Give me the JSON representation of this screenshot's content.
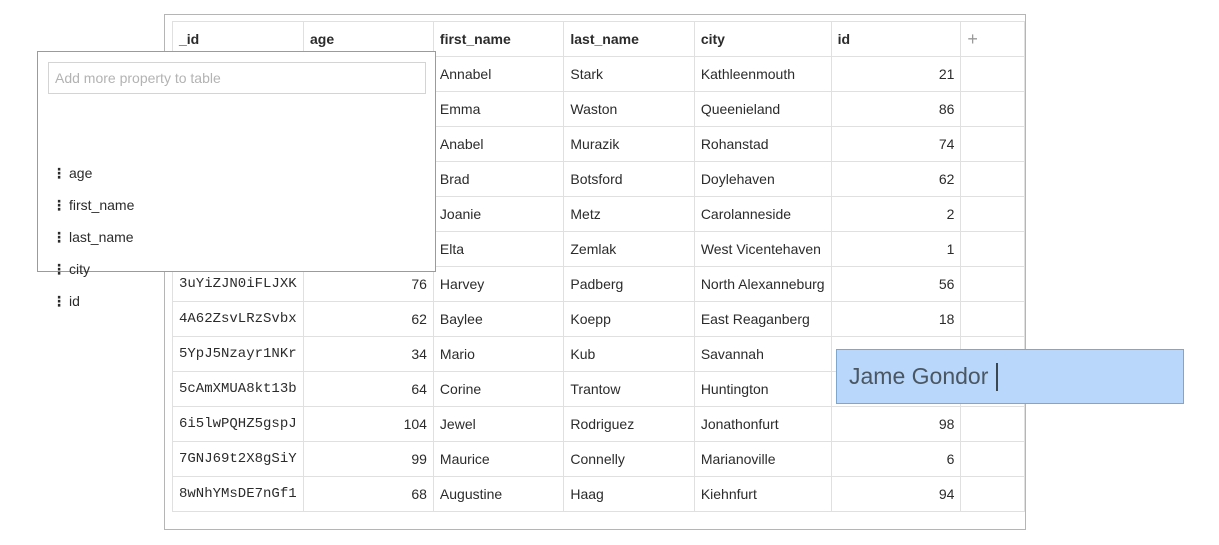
{
  "table": {
    "columns": [
      "_id",
      "age",
      "first_name",
      "last_name",
      "city",
      "id"
    ],
    "add_column_label": "+",
    "rows": [
      {
        "_id": "",
        "age": "",
        "first_name": "Annabel",
        "last_name": "Stark",
        "city": "Kathleenmouth",
        "id": "21"
      },
      {
        "_id": "",
        "age": "",
        "first_name": "Emma",
        "last_name": "Waston",
        "city": "Queenieland",
        "id": "86"
      },
      {
        "_id": "",
        "age": "",
        "first_name": "Anabel",
        "last_name": "Murazik",
        "city": "Rohanstad",
        "id": "74"
      },
      {
        "_id": "",
        "age": "",
        "first_name": "Brad",
        "last_name": "Botsford",
        "city": "Doylehaven",
        "id": "62"
      },
      {
        "_id": "",
        "age": "",
        "first_name": "Joanie",
        "last_name": "Metz",
        "city": "Carolanneside",
        "id": "2"
      },
      {
        "_id": "",
        "age": "",
        "first_name": "Elta",
        "last_name": "Zemlak",
        "city": "West Vicentehaven",
        "id": "1"
      },
      {
        "_id": "3uYiZJN0iFLJXK",
        "age": "76",
        "first_name": "Harvey",
        "last_name": "Padberg",
        "city": "North Alexanneburg",
        "id": "56"
      },
      {
        "_id": "4A62ZsvLRzSvbx",
        "age": "62",
        "first_name": "Baylee",
        "last_name": "Koepp",
        "city": "East Reaganberg",
        "id": "18"
      },
      {
        "_id": "5YpJ5Nzayr1NKr",
        "age": "34",
        "first_name": "Mario",
        "last_name": "Kub",
        "city": "Savannah",
        "id": ""
      },
      {
        "_id": "5cAmXMUA8kt13b",
        "age": "64",
        "first_name": "Corine",
        "last_name": "Trantow",
        "city": "Huntington",
        "id": ""
      },
      {
        "_id": "6i5lwPQHZ5gspJ",
        "age": "104",
        "first_name": "Jewel",
        "last_name": "Rodriguez",
        "city": "Jonathonfurt",
        "id": "98"
      },
      {
        "_id": "7GNJ69t2X8gSiY",
        "age": "99",
        "first_name": "Maurice",
        "last_name": "Connelly",
        "city": "Marianoville",
        "id": "6"
      },
      {
        "_id": "8wNhYMsDE7nGf1",
        "age": "68",
        "first_name": "Augustine",
        "last_name": "Haag",
        "city": "Kiehnfurt",
        "id": "94"
      }
    ]
  },
  "property_popup": {
    "placeholder": "Add more property to table",
    "grip_glyph": "⋮",
    "items": [
      "age",
      "first_name",
      "last_name",
      "city",
      "id"
    ]
  },
  "cell_editor": {
    "value": "Jame Gondor"
  }
}
